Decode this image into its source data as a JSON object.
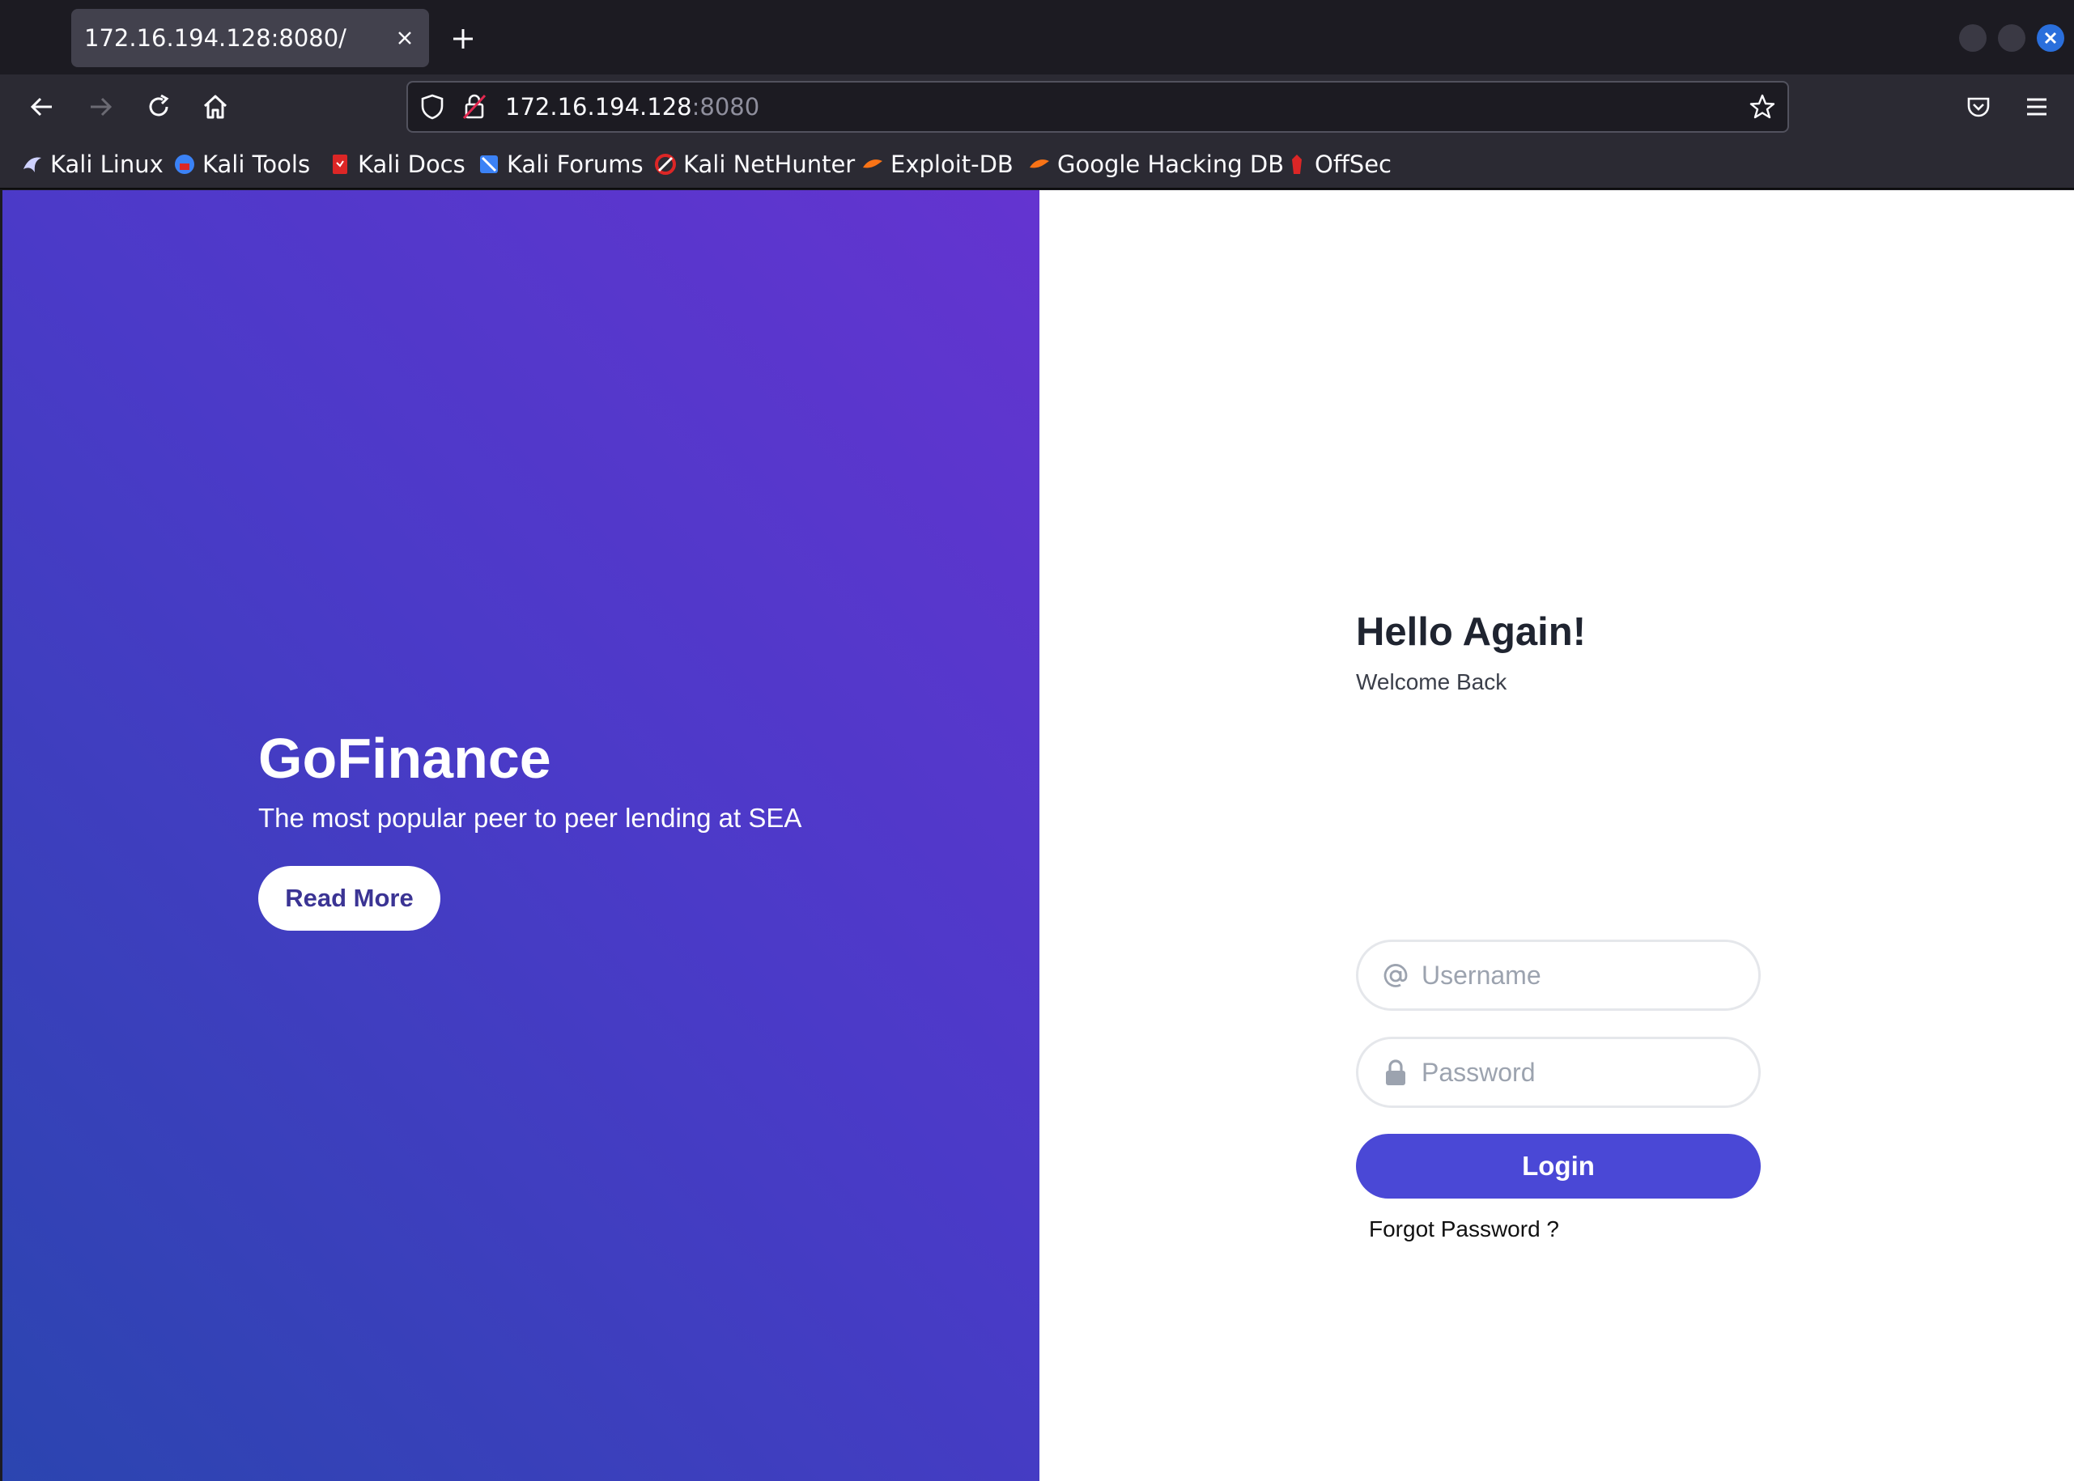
{
  "browser": {
    "tab_title": "172.16.194.128:8080/",
    "url_host": "172.16.194.128",
    "url_port": ":8080",
    "bookmarks": [
      {
        "label": "Kali Linux",
        "icon": "kali-dragon-icon",
        "color": "#9aa0ff"
      },
      {
        "label": "Kali Tools",
        "icon": "kali-tools-icon",
        "color": "#3b82f6"
      },
      {
        "label": "Kali Docs",
        "icon": "kali-docs-icon",
        "color": "#dc2626"
      },
      {
        "label": "Kali Forums",
        "icon": "kali-forums-icon",
        "color": "#3b82f6"
      },
      {
        "label": "Kali NetHunter",
        "icon": "kali-nethunter-icon",
        "color": "#dc2626"
      },
      {
        "label": "Exploit-DB",
        "icon": "exploit-db-icon",
        "color": "#f97316"
      },
      {
        "label": "Google Hacking DB",
        "icon": "ghdb-icon",
        "color": "#f97316"
      },
      {
        "label": "OffSec",
        "icon": "offsec-icon",
        "color": "#dc2626"
      }
    ]
  },
  "hero": {
    "brand": "GoFinance",
    "tagline": "The most popular peer to peer lending at SEA",
    "read_more": "Read More"
  },
  "login": {
    "title": "Hello Again!",
    "subtitle": "Welcome Back",
    "username_placeholder": "Username",
    "password_placeholder": "Password",
    "login_label": "Login",
    "forgot_label": "Forgot Password ?"
  },
  "colors": {
    "accent": "#4a48d6",
    "hero_gradient_start": "#6434d0",
    "hero_gradient_end": "#2b45b0"
  }
}
